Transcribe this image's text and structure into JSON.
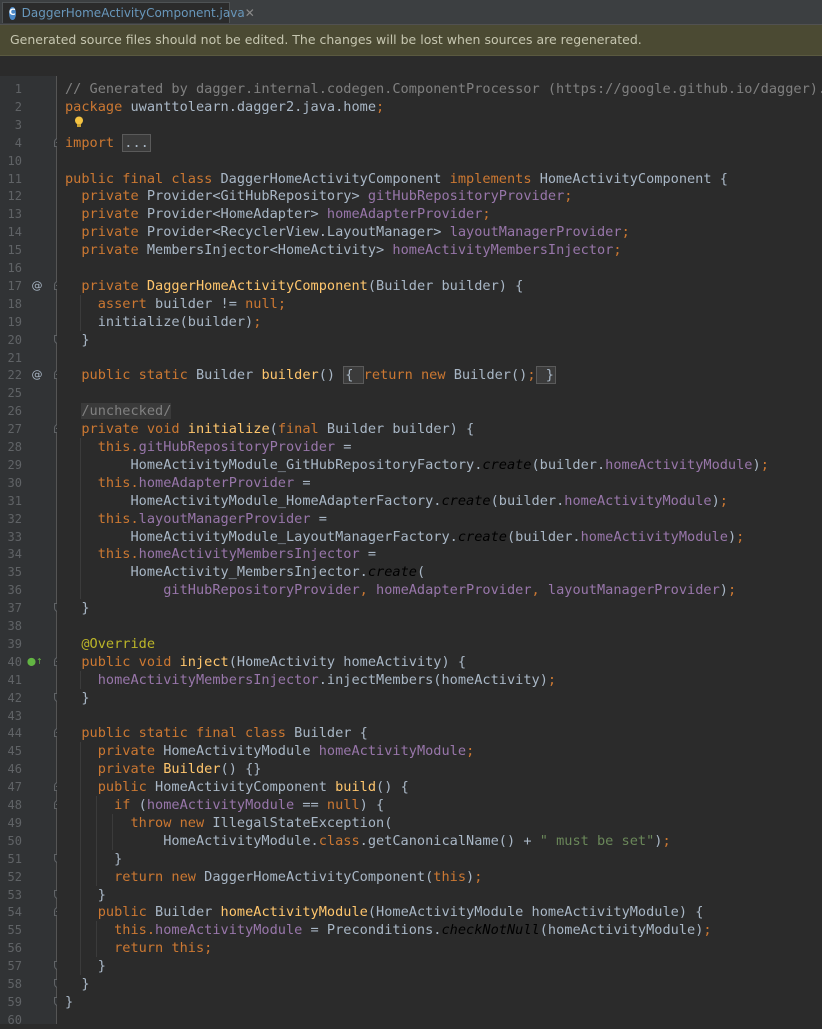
{
  "tab": {
    "label": "DaggerHomeActivityComponent.java",
    "close": "✕",
    "icon_letter": "C"
  },
  "banner": {
    "text": "Generated source files should not be edited. The changes will be lost when sources are regenerated."
  },
  "code_lines": [
    {
      "n": "1",
      "segs": [
        [
          "cm",
          "// Generated by dagger.internal.codegen.ComponentProcessor (https://google.github.io/dagger)."
        ]
      ]
    },
    {
      "n": "2",
      "segs": [
        [
          "kw",
          "package "
        ],
        [
          "pl",
          "uwanttolearn.dagger2.java.home"
        ],
        [
          "kw",
          ";"
        ]
      ]
    },
    {
      "n": "3",
      "segs": []
    },
    {
      "n": "4",
      "segs": [
        [
          "kw",
          "import "
        ],
        [
          "foldbox",
          "..."
        ]
      ]
    },
    {
      "n": "10",
      "segs": []
    },
    {
      "n": "11",
      "segs": [
        [
          "kw",
          "public final class "
        ],
        [
          "pl",
          "DaggerHomeActivityComponent "
        ],
        [
          "kw",
          "implements "
        ],
        [
          "pl",
          "HomeActivityComponent {"
        ]
      ]
    },
    {
      "n": "12",
      "segs": [
        [
          "pl",
          "  "
        ],
        [
          "kw",
          "private "
        ],
        [
          "pl",
          "Provider<GitHubRepository> "
        ],
        [
          "fld",
          "gitHubRepositoryProvider"
        ],
        [
          "kw",
          ";"
        ]
      ]
    },
    {
      "n": "13",
      "segs": [
        [
          "pl",
          "  "
        ],
        [
          "kw",
          "private "
        ],
        [
          "pl",
          "Provider<HomeAdapter> "
        ],
        [
          "fld",
          "homeAdapterProvider"
        ],
        [
          "kw",
          ";"
        ]
      ]
    },
    {
      "n": "14",
      "segs": [
        [
          "pl",
          "  "
        ],
        [
          "kw",
          "private "
        ],
        [
          "pl",
          "Provider<RecyclerView.LayoutManager> "
        ],
        [
          "fld",
          "layoutManagerProvider"
        ],
        [
          "kw",
          ";"
        ]
      ]
    },
    {
      "n": "15",
      "segs": [
        [
          "pl",
          "  "
        ],
        [
          "kw",
          "private "
        ],
        [
          "pl",
          "MembersInjector<HomeActivity> "
        ],
        [
          "fld",
          "homeActivityMembersInjector"
        ],
        [
          "kw",
          ";"
        ]
      ]
    },
    {
      "n": "16",
      "segs": []
    },
    {
      "n": "17",
      "segs": [
        [
          "pl",
          "  "
        ],
        [
          "kw",
          "private "
        ],
        [
          "fn",
          "DaggerHomeActivityComponent"
        ],
        [
          "pl",
          "(Builder builder) {"
        ]
      ]
    },
    {
      "n": "18",
      "segs": [
        [
          "pl",
          "    "
        ],
        [
          "kw",
          "assert "
        ],
        [
          "pl",
          "builder != "
        ],
        [
          "kw",
          "null;"
        ]
      ]
    },
    {
      "n": "19",
      "segs": [
        [
          "pl",
          "    initialize(builder)"
        ],
        [
          "kw",
          ";"
        ]
      ]
    },
    {
      "n": "20",
      "segs": [
        [
          "pl",
          "  }"
        ]
      ]
    },
    {
      "n": "21",
      "segs": []
    },
    {
      "n": "22",
      "segs": [
        [
          "pl",
          "  "
        ],
        [
          "kw",
          "public static "
        ],
        [
          "pl",
          "Builder "
        ],
        [
          "fn",
          "builder"
        ],
        [
          "pl",
          "() "
        ],
        [
          "foldbox",
          "{ "
        ],
        [
          "kw",
          "return new "
        ],
        [
          "pl",
          "Builder()"
        ],
        [
          "kw",
          ";"
        ],
        [
          "foldbox",
          " }"
        ]
      ]
    },
    {
      "n": "25",
      "segs": []
    },
    {
      "n": "26",
      "segs": [
        [
          "pl",
          "  "
        ],
        [
          "unchecked",
          "/unchecked/"
        ]
      ]
    },
    {
      "n": "27",
      "segs": [
        [
          "pl",
          "  "
        ],
        [
          "kw",
          "private void "
        ],
        [
          "fn",
          "initialize"
        ],
        [
          "pl",
          "("
        ],
        [
          "kw",
          "final "
        ],
        [
          "pl",
          "Builder builder) {"
        ]
      ]
    },
    {
      "n": "28",
      "segs": [
        [
          "pl",
          "    "
        ],
        [
          "kw",
          "this."
        ],
        [
          "fld",
          "gitHubRepositoryProvider "
        ],
        [
          "pl",
          "="
        ]
      ]
    },
    {
      "n": "29",
      "segs": [
        [
          "pl",
          "        HomeActivityModule_GitHubRepositoryFactory."
        ],
        [
          "it",
          "create"
        ],
        [
          "pl",
          "(builder."
        ],
        [
          "fld",
          "homeActivityModule"
        ],
        [
          "pl",
          ")"
        ],
        [
          "kw",
          ";"
        ]
      ]
    },
    {
      "n": "30",
      "segs": [
        [
          "pl",
          "    "
        ],
        [
          "kw",
          "this."
        ],
        [
          "fld",
          "homeAdapterProvider "
        ],
        [
          "pl",
          "="
        ]
      ]
    },
    {
      "n": "31",
      "segs": [
        [
          "pl",
          "        HomeActivityModule_HomeAdapterFactory."
        ],
        [
          "it",
          "create"
        ],
        [
          "pl",
          "(builder."
        ],
        [
          "fld",
          "homeActivityModule"
        ],
        [
          "pl",
          ")"
        ],
        [
          "kw",
          ";"
        ]
      ]
    },
    {
      "n": "32",
      "segs": [
        [
          "pl",
          "    "
        ],
        [
          "kw",
          "this."
        ],
        [
          "fld",
          "layoutManagerProvider "
        ],
        [
          "pl",
          "="
        ]
      ]
    },
    {
      "n": "33",
      "segs": [
        [
          "pl",
          "        HomeActivityModule_LayoutManagerFactory."
        ],
        [
          "it",
          "create"
        ],
        [
          "pl",
          "(builder."
        ],
        [
          "fld",
          "homeActivityModule"
        ],
        [
          "pl",
          ")"
        ],
        [
          "kw",
          ";"
        ]
      ]
    },
    {
      "n": "34",
      "segs": [
        [
          "pl",
          "    "
        ],
        [
          "kw",
          "this."
        ],
        [
          "fld",
          "homeActivityMembersInjector "
        ],
        [
          "pl",
          "="
        ]
      ]
    },
    {
      "n": "35",
      "segs": [
        [
          "pl",
          "        HomeActivity_MembersInjector."
        ],
        [
          "it",
          "create"
        ],
        [
          "pl",
          "("
        ]
      ]
    },
    {
      "n": "36",
      "segs": [
        [
          "pl",
          "            "
        ],
        [
          "fld",
          "gitHubRepositoryProvider"
        ],
        [
          "kw",
          ", "
        ],
        [
          "fld",
          "homeAdapterProvider"
        ],
        [
          "kw",
          ", "
        ],
        [
          "fld",
          "layoutManagerProvider"
        ],
        [
          "pl",
          ")"
        ],
        [
          "kw",
          ";"
        ]
      ]
    },
    {
      "n": "37",
      "segs": [
        [
          "pl",
          "  }"
        ]
      ]
    },
    {
      "n": "38",
      "segs": []
    },
    {
      "n": "39",
      "segs": [
        [
          "pl",
          "  "
        ],
        [
          "ann",
          "@Override"
        ]
      ]
    },
    {
      "n": "40",
      "segs": [
        [
          "pl",
          "  "
        ],
        [
          "kw",
          "public void "
        ],
        [
          "fn",
          "inject"
        ],
        [
          "pl",
          "(HomeActivity homeActivity) {"
        ]
      ]
    },
    {
      "n": "41",
      "segs": [
        [
          "pl",
          "    "
        ],
        [
          "fld",
          "homeActivityMembersInjector"
        ],
        [
          "pl",
          ".injectMembers(homeActivity)"
        ],
        [
          "kw",
          ";"
        ]
      ]
    },
    {
      "n": "42",
      "segs": [
        [
          "pl",
          "  }"
        ]
      ]
    },
    {
      "n": "43",
      "segs": []
    },
    {
      "n": "44",
      "segs": [
        [
          "pl",
          "  "
        ],
        [
          "kw",
          "public static final class "
        ],
        [
          "pl",
          "Builder {"
        ]
      ]
    },
    {
      "n": "45",
      "segs": [
        [
          "pl",
          "    "
        ],
        [
          "kw",
          "private "
        ],
        [
          "pl",
          "HomeActivityModule "
        ],
        [
          "fld",
          "homeActivityModule"
        ],
        [
          "kw",
          ";"
        ]
      ]
    },
    {
      "n": "46",
      "segs": [
        [
          "pl",
          "    "
        ],
        [
          "kw",
          "private "
        ],
        [
          "fn",
          "Builder"
        ],
        [
          "pl",
          "() {}"
        ]
      ]
    },
    {
      "n": "47",
      "segs": [
        [
          "pl",
          "    "
        ],
        [
          "kw",
          "public "
        ],
        [
          "pl",
          "HomeActivityComponent "
        ],
        [
          "fn",
          "build"
        ],
        [
          "pl",
          "() {"
        ]
      ]
    },
    {
      "n": "48",
      "segs": [
        [
          "pl",
          "      "
        ],
        [
          "kw",
          "if "
        ],
        [
          "pl",
          "("
        ],
        [
          "fld",
          "homeActivityModule "
        ],
        [
          "pl",
          "== "
        ],
        [
          "kw",
          "null"
        ],
        [
          "pl",
          ") {"
        ]
      ]
    },
    {
      "n": "49",
      "segs": [
        [
          "pl",
          "        "
        ],
        [
          "kw",
          "throw new "
        ],
        [
          "pl",
          "IllegalStateException("
        ]
      ]
    },
    {
      "n": "50",
      "segs": [
        [
          "pl",
          "            HomeActivityModule."
        ],
        [
          "kw",
          "class"
        ],
        [
          "pl",
          ".getCanonicalName() + "
        ],
        [
          "str",
          "\" must be set\""
        ],
        [
          "pl",
          ")"
        ],
        [
          "kw",
          ";"
        ]
      ]
    },
    {
      "n": "51",
      "segs": [
        [
          "pl",
          "      }"
        ]
      ]
    },
    {
      "n": "52",
      "segs": [
        [
          "pl",
          "      "
        ],
        [
          "kw",
          "return new "
        ],
        [
          "pl",
          "DaggerHomeActivityComponent("
        ],
        [
          "kw",
          "this"
        ],
        [
          "pl",
          ")"
        ],
        [
          "kw",
          ";"
        ]
      ]
    },
    {
      "n": "53",
      "segs": [
        [
          "pl",
          "    }"
        ]
      ]
    },
    {
      "n": "54",
      "segs": [
        [
          "pl",
          "    "
        ],
        [
          "kw",
          "public "
        ],
        [
          "pl",
          "Builder "
        ],
        [
          "fn",
          "homeActivityModule"
        ],
        [
          "pl",
          "(HomeActivityModule homeActivityModule) {"
        ]
      ]
    },
    {
      "n": "55",
      "segs": [
        [
          "pl",
          "      "
        ],
        [
          "kw",
          "this."
        ],
        [
          "fld",
          "homeActivityModule "
        ],
        [
          "pl",
          "= Preconditions."
        ],
        [
          "it",
          "checkNotNull"
        ],
        [
          "pl",
          "(homeActivityModule)"
        ],
        [
          "kw",
          ";"
        ]
      ]
    },
    {
      "n": "56",
      "segs": [
        [
          "pl",
          "      "
        ],
        [
          "kw",
          "return this;"
        ]
      ]
    },
    {
      "n": "57",
      "segs": [
        [
          "pl",
          "    }"
        ]
      ]
    },
    {
      "n": "58",
      "segs": [
        [
          "pl",
          "  }"
        ]
      ]
    },
    {
      "n": "59",
      "segs": [
        [
          "pl",
          "}"
        ]
      ]
    },
    {
      "n": "60",
      "segs": []
    }
  ],
  "gutter_marks": [
    {
      "line": "17",
      "symbol": "@"
    },
    {
      "line": "22",
      "symbol": "@"
    },
    {
      "line": "40",
      "symbol": "⬤↑"
    }
  ],
  "colors": {
    "keyword": "#cc7832",
    "field": "#9876aa",
    "method": "#ffc66d",
    "comment": "#808080",
    "string": "#6a8759",
    "annotation": "#bbb529",
    "plain": "#a9b7c6"
  }
}
